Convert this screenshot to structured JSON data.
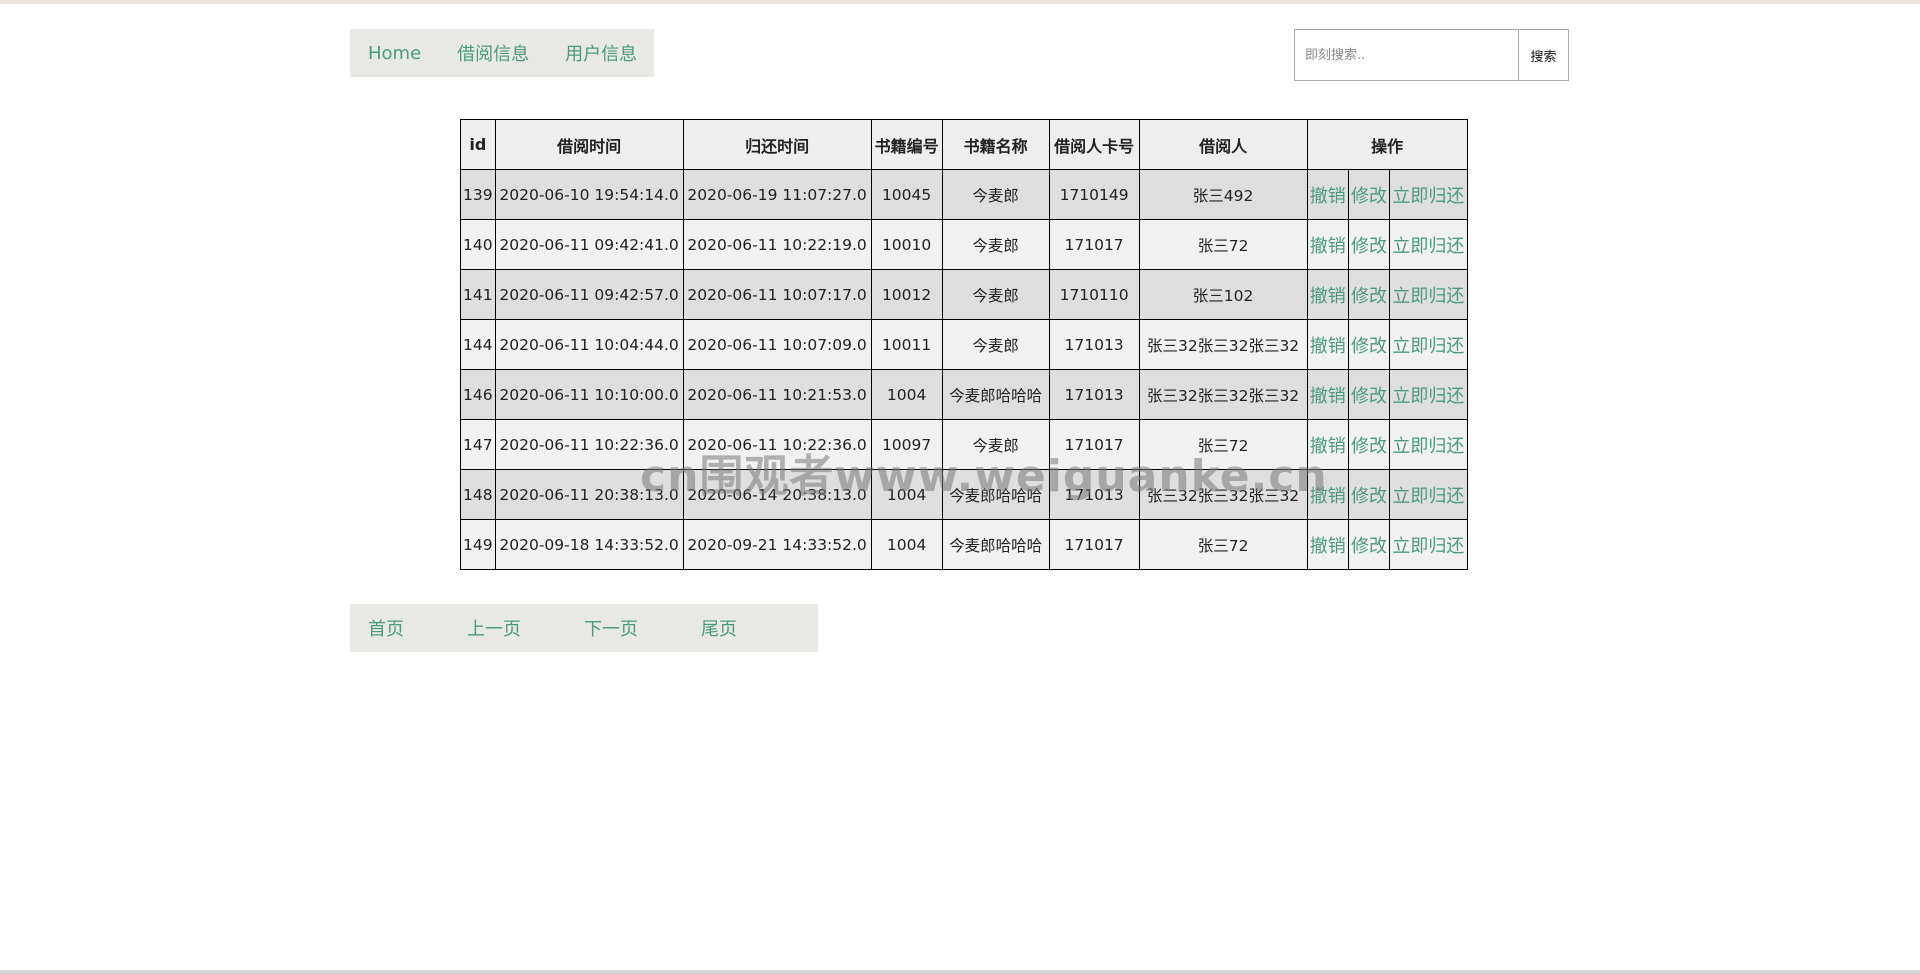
{
  "nav": {
    "items": [
      "Home",
      "借阅信息",
      "用户信息"
    ]
  },
  "search": {
    "placeholder": "即刻搜索..",
    "button_label": "搜索"
  },
  "table": {
    "headers": [
      "id",
      "借阅时间",
      "归还时间",
      "书籍编号",
      "书籍名称",
      "借阅人卡号",
      "借阅人",
      "操作"
    ],
    "rows": [
      {
        "id": "139",
        "borrow_time": "2020-06-10 19:54:14.0",
        "return_time": "2020-06-19 11:07:27.0",
        "book_no": "10045",
        "book_name": "今麦郎",
        "card_no": "1710149",
        "borrower": "张三492"
      },
      {
        "id": "140",
        "borrow_time": "2020-06-11 09:42:41.0",
        "return_time": "2020-06-11 10:22:19.0",
        "book_no": "10010",
        "book_name": "今麦郎",
        "card_no": "171017",
        "borrower": "张三72"
      },
      {
        "id": "141",
        "borrow_time": "2020-06-11 09:42:57.0",
        "return_time": "2020-06-11 10:07:17.0",
        "book_no": "10012",
        "book_name": "今麦郎",
        "card_no": "1710110",
        "borrower": "张三102"
      },
      {
        "id": "144",
        "borrow_time": "2020-06-11 10:04:44.0",
        "return_time": "2020-06-11 10:07:09.0",
        "book_no": "10011",
        "book_name": "今麦郎",
        "card_no": "171013",
        "borrower": "张三32张三32张三32"
      },
      {
        "id": "146",
        "borrow_time": "2020-06-11 10:10:00.0",
        "return_time": "2020-06-11 10:21:53.0",
        "book_no": "1004",
        "book_name": "今麦郎哈哈哈",
        "card_no": "171013",
        "borrower": "张三32张三32张三32"
      },
      {
        "id": "147",
        "borrow_time": "2020-06-11 10:22:36.0",
        "return_time": "2020-06-11 10:22:36.0",
        "book_no": "10097",
        "book_name": "今麦郎",
        "card_no": "171017",
        "borrower": "张三72"
      },
      {
        "id": "148",
        "borrow_time": "2020-06-11 20:38:13.0",
        "return_time": "2020-06-14 20:38:13.0",
        "book_no": "1004",
        "book_name": "今麦郎哈哈哈",
        "card_no": "171013",
        "borrower": "张三32张三32张三32"
      },
      {
        "id": "149",
        "borrow_time": "2020-09-18 14:33:52.0",
        "return_time": "2020-09-21 14:33:52.0",
        "book_no": "1004",
        "book_name": "今麦郎哈哈哈",
        "card_no": "171017",
        "borrower": "张三72"
      }
    ],
    "actions": {
      "revoke": "撤销",
      "edit": "修改",
      "return_now": "立即归还"
    }
  },
  "pager": {
    "items": [
      "首页",
      "上一页",
      "下一页",
      "尾页"
    ]
  },
  "watermark": "cn围观者www.weiguanke.cn",
  "colors": {
    "link": "#4c9a7e",
    "nav_bg": "#e8e8e4",
    "row_odd": "#dedede",
    "row_even": "#f1f1f1"
  }
}
